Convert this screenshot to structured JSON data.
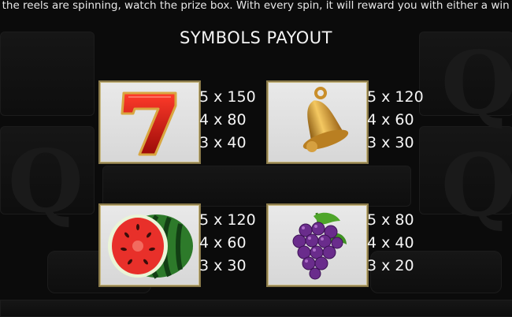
{
  "marquee_text": "e the reels are spinning, watch the prize box. With every spin, it will reward you with either a win mult",
  "title": "SYMBOLS PAYOUT",
  "symbols": [
    {
      "name": "Seven",
      "icon": "seven-icon",
      "payouts": [
        "5 x 150",
        "4 x 80",
        "3 x 40"
      ]
    },
    {
      "name": "Bell",
      "icon": "bell-icon",
      "payouts": [
        "5 x 120",
        "4 x 60",
        "3 x 30"
      ]
    },
    {
      "name": "Watermelon",
      "icon": "watermelon-icon",
      "payouts": [
        "5 x 120",
        "4 x 60",
        "3 x 30"
      ]
    },
    {
      "name": "Grapes",
      "icon": "grapes-icon",
      "payouts": [
        "5 x 80",
        "4 x 40",
        "3 x 20"
      ]
    }
  ],
  "colors": {
    "background": "#0b0b0b",
    "card": "#dcdcdc",
    "card_border": "#8a7a4a",
    "text": "#f5f5f5"
  }
}
